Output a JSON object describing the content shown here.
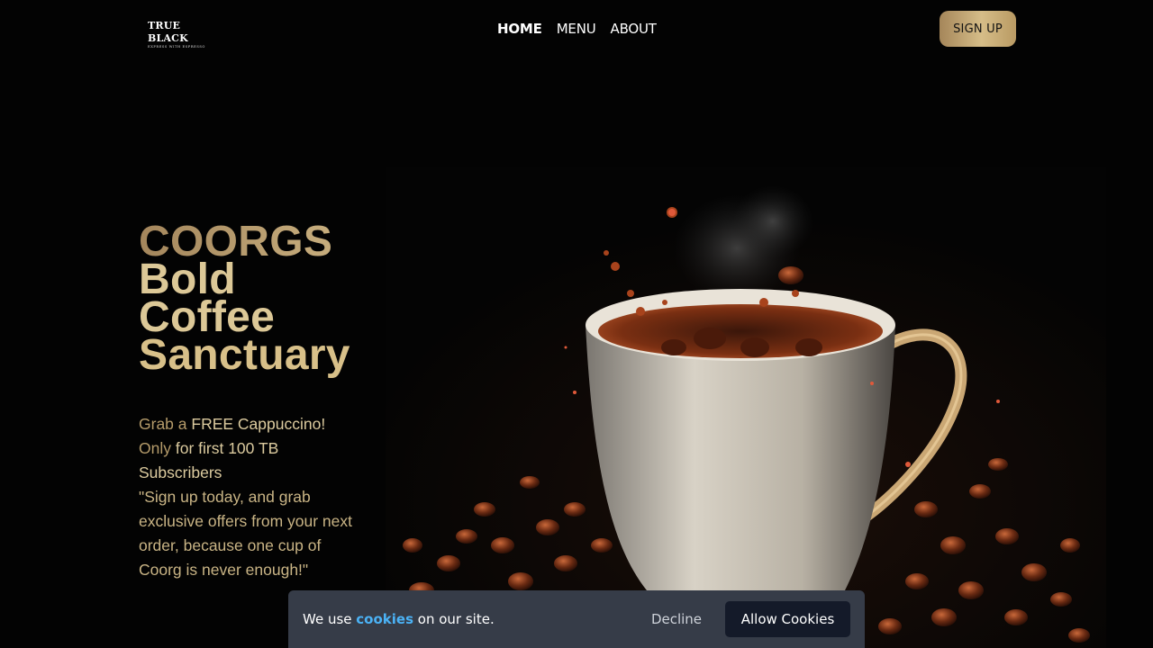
{
  "brand": {
    "name": "TRUE BLACK",
    "tagline": "EXPRESS WITH ESPRESSO"
  },
  "nav": {
    "items": [
      {
        "label": "HOME",
        "active": true
      },
      {
        "label": "MENU",
        "active": false
      },
      {
        "label": "ABOUT",
        "active": false
      }
    ],
    "signup_label": "SIGN UP"
  },
  "hero": {
    "title_lines": [
      "COORGS",
      "Bold",
      "Coffee",
      "Sanctuary"
    ],
    "promo": {
      "p1": "Grab a",
      "p2": "FREE Cappuccino!",
      "p3": "Only",
      "p4": "for first 100 TB Subscribers",
      "quote": "\"Sign up today, and grab exclusive offers from your next order, because one cup of Coorg is never enough!\""
    }
  },
  "cookie_banner": {
    "text_before": "We use",
    "link_text": "cookies",
    "text_after": "on our site.",
    "decline_label": "Decline",
    "allow_label": "Allow Cookies"
  },
  "colors": {
    "background": "#030303",
    "gold": "#d6bd88",
    "gold_dark": "#a5865a",
    "cookie_bar": "#363c48",
    "cookie_link": "#4bb2f5",
    "allow_button": "#141a29"
  }
}
